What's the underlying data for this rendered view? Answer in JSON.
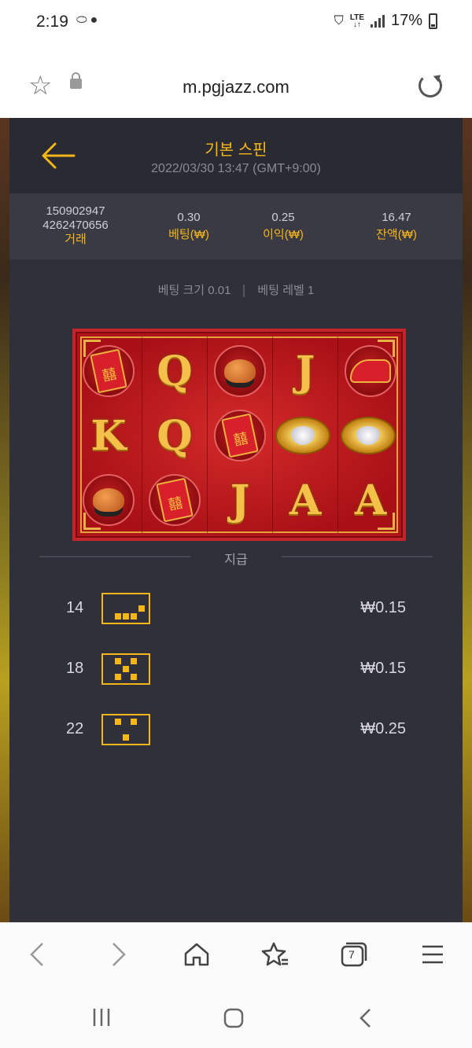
{
  "status_bar": {
    "time": "2:19",
    "notification_icons": [
      "pill-icon",
      "chat-bubble-icon"
    ],
    "network": "LTE",
    "battery": "17%"
  },
  "browser": {
    "url": "m.pgjazz.com",
    "tab_count": "7"
  },
  "game": {
    "title": "기본 스핀",
    "datetime": "2022/03/30 13:47 (GMT+9:00)",
    "accent_color": "#f5b619",
    "stats": {
      "transaction_id_line1": "150902947",
      "transaction_id_line2": "4262470656",
      "transaction_label": "거래",
      "bet_value": "0.30",
      "bet_label": "베팅(₩)",
      "profit_value": "0.25",
      "profit_label": "이익(₩)",
      "balance_value": "16.47",
      "balance_label": "잔액(₩)"
    },
    "bet_size_text": "베팅 크기 0.01",
    "bet_level_text": "베팅 레벨 1",
    "reels": [
      [
        "red-envelope",
        "Q",
        "mooncake",
        "J",
        "red-shoe"
      ],
      [
        "K",
        "Q",
        "red-envelope",
        "gold-ring",
        "gold-ring"
      ],
      [
        "mooncake",
        "red-envelopes",
        "J",
        "A",
        "A"
      ]
    ],
    "payout_title": "지급",
    "payouts": [
      {
        "line": "14",
        "amount": "₩0.15",
        "pattern": [
          0,
          0,
          0,
          0,
          0,
          0,
          0,
          0,
          0,
          1,
          0,
          1,
          1,
          1,
          0
        ]
      },
      {
        "line": "18",
        "amount": "₩0.15",
        "pattern": [
          0,
          1,
          0,
          1,
          0,
          0,
          0,
          1,
          0,
          0,
          0,
          1,
          0,
          1,
          0
        ]
      },
      {
        "line": "22",
        "amount": "₩0.25",
        "pattern": [
          0,
          1,
          0,
          1,
          0,
          0,
          0,
          0,
          0,
          0,
          0,
          0,
          1,
          0,
          0
        ]
      }
    ]
  }
}
